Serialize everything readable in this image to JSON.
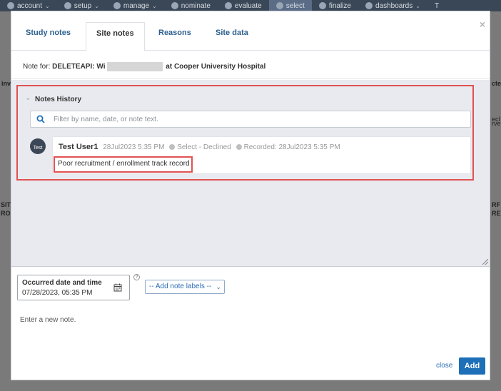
{
  "topnav": {
    "items": [
      {
        "label": "account",
        "icon": "user-circle-icon"
      },
      {
        "label": "setup",
        "icon": "gear-icon"
      },
      {
        "label": "manage",
        "icon": "person-icon"
      },
      {
        "label": "nominate",
        "icon": "thumbs-up-icon"
      },
      {
        "label": "evaluate",
        "icon": "search-icon"
      },
      {
        "label": "select",
        "icon": "list-icon",
        "active": true
      },
      {
        "label": "finalize",
        "icon": "check-circle-icon"
      },
      {
        "label": "dashboards",
        "icon": "pie-chart-icon"
      }
    ],
    "overflow_letter": "T"
  },
  "background": {
    "stub_left_1": "inv",
    "stub_right_1": "cte",
    "stub_right_2": "ecl",
    "stub_right_3": "rve",
    "stub_left_2": "SIT",
    "stub_left_3": "ROF",
    "stub_right_4": "RF",
    "stub_right_5": "RE"
  },
  "modal": {
    "close_glyph": "×",
    "tabs": [
      {
        "label": "Study notes"
      },
      {
        "label": "Site notes",
        "active": true
      },
      {
        "label": "Reasons"
      },
      {
        "label": "Site data"
      }
    ],
    "note_for": {
      "prefix": "Note for:",
      "subject_start": "DELETEAPI: Wi",
      "subject_end": "at Cooper University Hospital"
    },
    "history": {
      "title": "Notes History",
      "filter_placeholder": "Filter by name, date, or note text.",
      "notes": [
        {
          "avatar_text": "Test",
          "author": "Test User1",
          "date": "28Jul2023",
          "time": "5:35 PM",
          "status": "Select - Declined",
          "recorded": "Recorded: 28Jul2023  5:35 PM",
          "text": "Poor recruitment / enrollment track record"
        }
      ]
    },
    "composer": {
      "date_label": "Occurred date and time",
      "date_value": "07/28/2023, 05:35 PM",
      "help_glyph": "?",
      "labels_select": "-- Add note labels --",
      "note_placeholder": "Enter a new note.",
      "close_label": "close",
      "add_label": "Add"
    }
  },
  "colors": {
    "accent_blue": "#1d6fb8",
    "link_blue": "#2a6db5",
    "highlight_red": "#e05252",
    "nav_bg": "#3a4757",
    "history_bg": "#e9eaef"
  }
}
